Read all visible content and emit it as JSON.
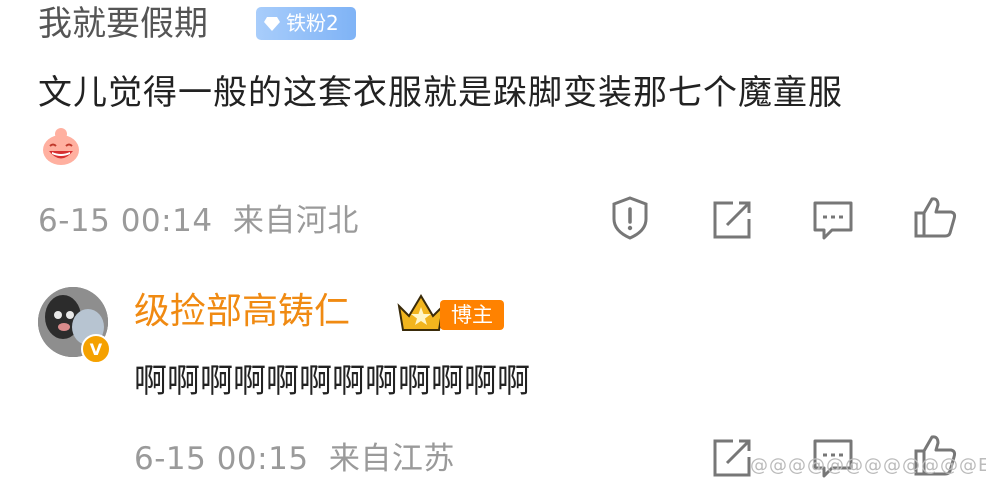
{
  "comment1": {
    "username": "我就要假期",
    "fan_badge": "铁粉2",
    "text": "文儿觉得一般的这套衣服就是跺脚变装那七个魔童服",
    "time": "6-15 00:14",
    "location": "来自河北",
    "actions": [
      "report-icon",
      "share-icon",
      "comment-icon",
      "like-icon"
    ]
  },
  "comment2": {
    "username": "级捡部高铸仁",
    "author_badge": "博主",
    "verified": "V",
    "text": "啊啊啊啊啊啊啊啊啊啊啊啊",
    "time": "6-15 00:15",
    "location": "来自江苏",
    "actions": [
      "share-icon",
      "comment-icon",
      "like-icon"
    ]
  },
  "watermark": "@@@@@@@@@@@@E",
  "colors": {
    "username_orange": "#f08a12",
    "badge_orange": "#ff8200",
    "meta_gray": "#9a9a9a",
    "fan_blue": "#7fb3f6"
  }
}
